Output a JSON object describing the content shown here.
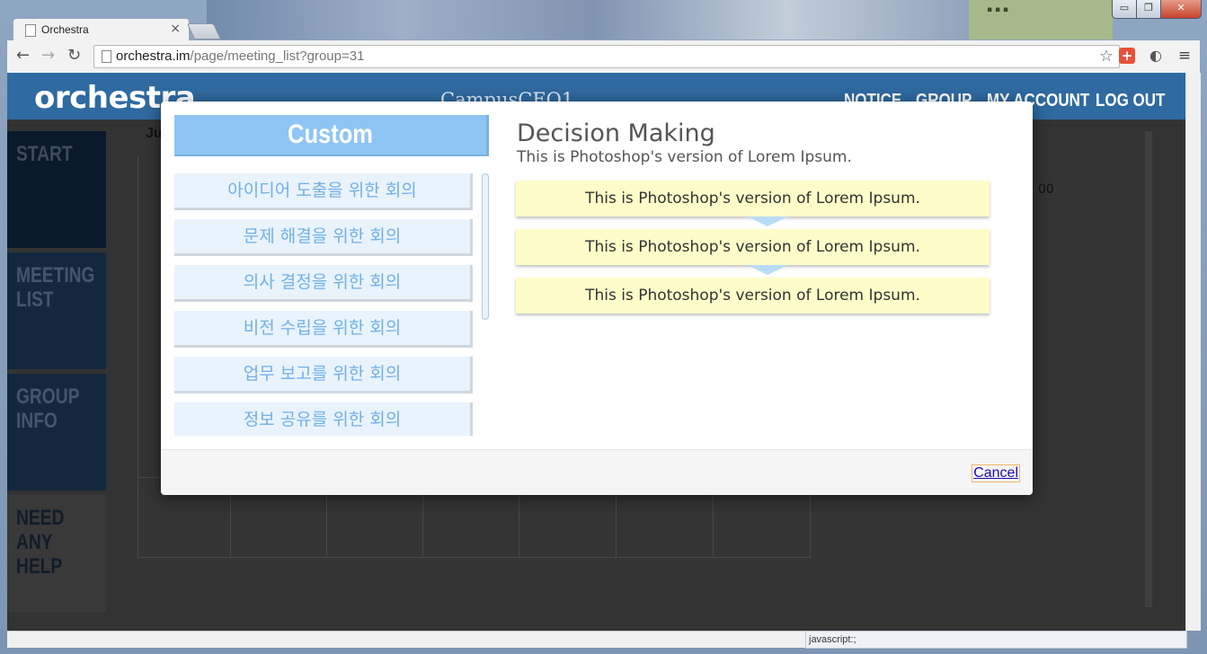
{
  "browser": {
    "tab_title": "Orchestra",
    "tab_close": "×",
    "url_host": "orchestra.im",
    "url_path": "/page/meeting_list?group=31",
    "status_text": "javascript:;",
    "window_controls": {
      "minimize": "▭",
      "maximize": "❐",
      "close": "✕"
    }
  },
  "site": {
    "logo": "orchestra",
    "group_name": "CampusCEO1",
    "nav": [
      "NOTICE",
      "GROUP",
      "MY ACCOUNT",
      "LOG OUT"
    ],
    "sidebar": [
      "START",
      "MEETING LIST",
      "GROUP INFO",
      "NEED ANY HELP"
    ],
    "background_fragments": {
      "calendar_label": "Ju",
      "time_label": "00"
    }
  },
  "modal": {
    "category_header": "Custom",
    "categories": [
      "아이디어 도출을 위한 회의",
      "문제 해결을 위한 회의",
      "의사 결정을 위한 회의",
      "비전 수립을 위한 회의",
      "업무 보고를 위한 회의",
      "정보 공유를 위한 회의"
    ],
    "detail_title": "Decision Making",
    "detail_subtitle": "This is Photoshop's version of Lorem Ipsum.",
    "steps": [
      "This is Photoshop's version of Lorem Ipsum.",
      "This is Photoshop's version of Lorem Ipsum.",
      "This is Photoshop's version of Lorem Ipsum."
    ],
    "cancel_label": "Cancel"
  },
  "colors": {
    "header_blue": "#2f6aa0",
    "category_header": "#8ec5f5",
    "list_item_bg": "#e9f3fc",
    "list_item_text": "#6fb1e6",
    "step_bg": "#fefdca",
    "step_arrow": "#b9dcf6",
    "sidebar_start": "#0a1a2c",
    "sidebar_meeting": "#13283f",
    "sidebar_group": "#13283f",
    "sidebar_help": "#393939"
  }
}
